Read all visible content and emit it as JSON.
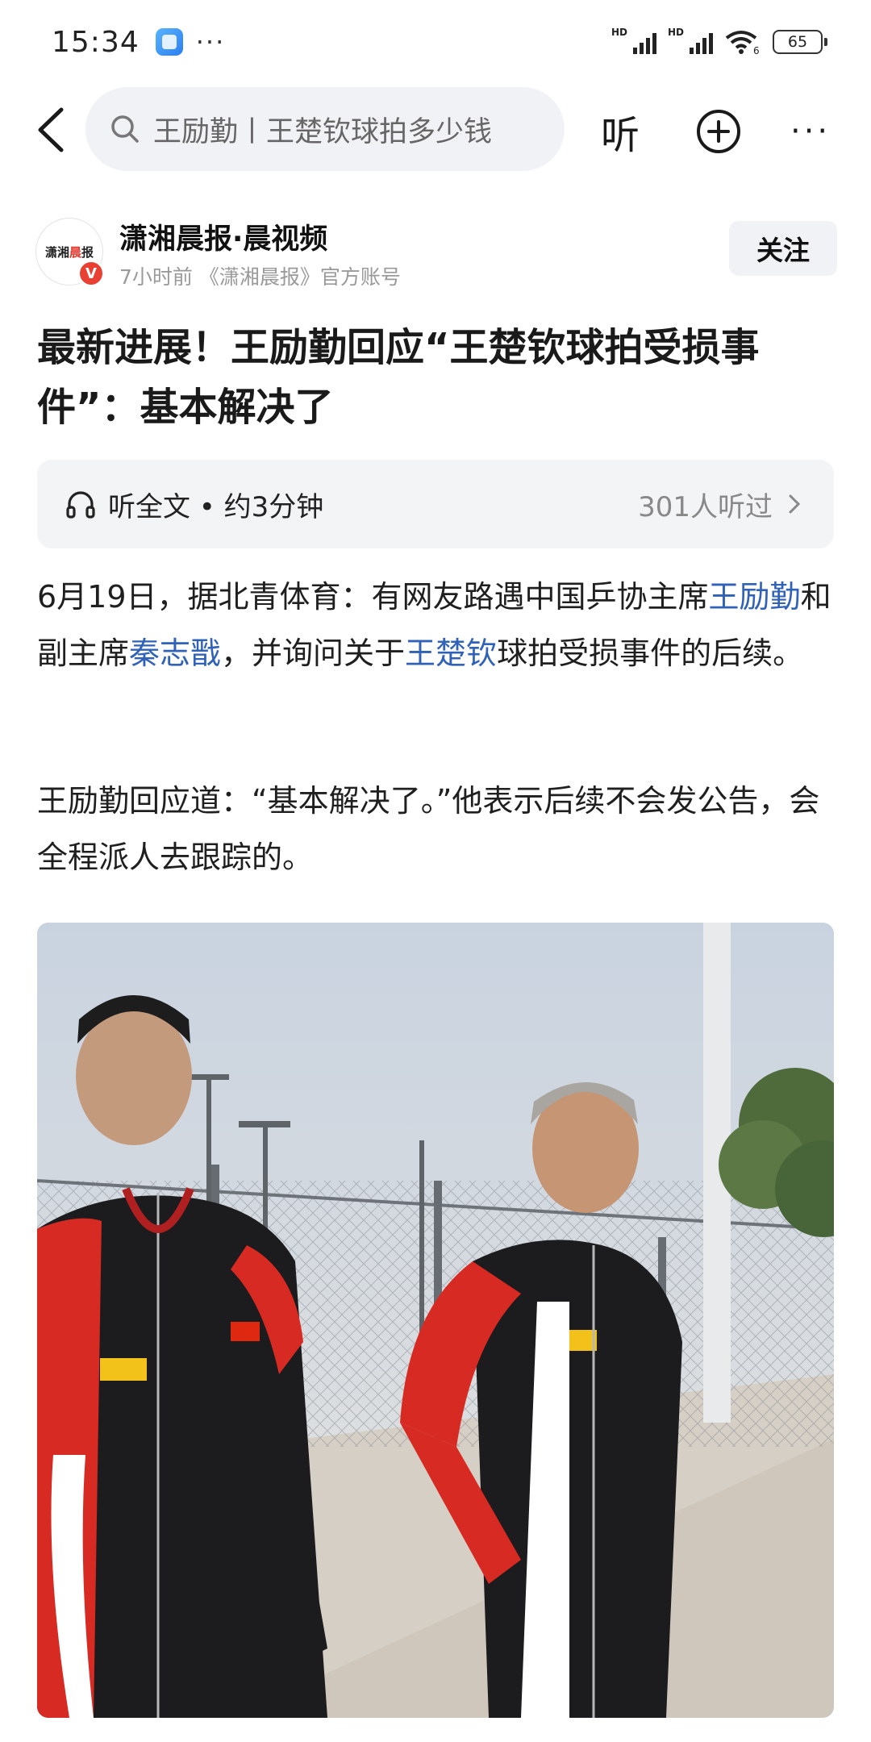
{
  "status_bar": {
    "time": "15:34",
    "more": "···",
    "signal_1_label": "HD",
    "signal_2_label": "HD",
    "wifi_label": "6",
    "battery": "65"
  },
  "search": {
    "query": "王励勤丨王楚钦球拍多少钱",
    "listen_label": "听"
  },
  "author": {
    "avatar_text_1": "潇湘",
    "avatar_text_2": "晨",
    "avatar_text_3": "报",
    "verified_mark": "V",
    "name": "潇湘晨报·晨视频",
    "meta": "7小时前 《潇湘晨报》官方账号",
    "follow_label": "关注"
  },
  "article": {
    "title_line_1": "最新进展！王励勤回应“王楚钦球拍受损事",
    "title_line_2": "件”：基本解决了",
    "listen_bar": {
      "label": "听全文 • 约3分钟",
      "count": "301人听过"
    },
    "p1": {
      "t1": "6月19日，据北青体育：有网友路遇中国乒协主席",
      "link1": "王励勤",
      "t2": "和副主席",
      "link2": "秦志戬",
      "t3": "，并询问关于",
      "link3": "王楚钦",
      "t4": "球拍受损事件的后续。"
    },
    "p2": "王励勤回应道：“基本解决了。”他表示后续不会发公告，会全程派人去跟踪的。"
  },
  "colors": {
    "link": "#2f62b8",
    "follow_bg": "#f1f2f5",
    "jacket_red": "#d72a23",
    "jacket_black": "#1c1c1e"
  }
}
